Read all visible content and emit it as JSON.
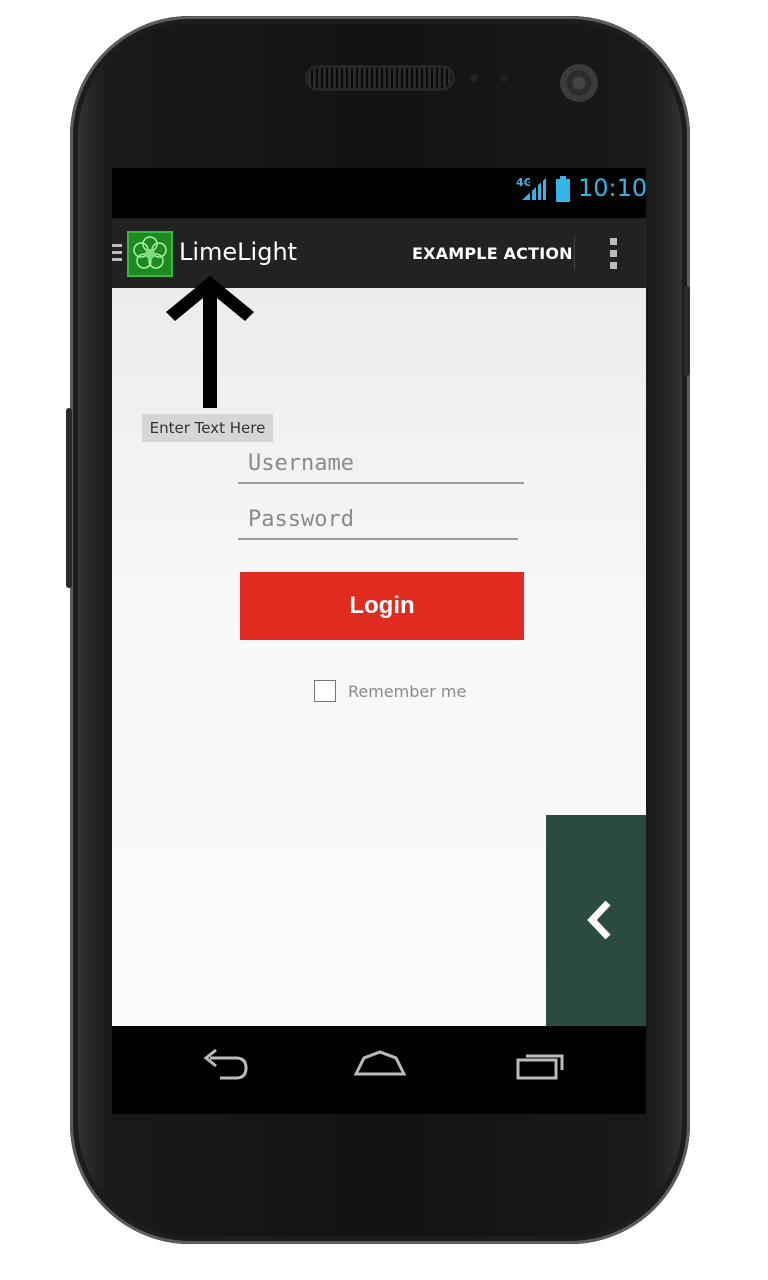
{
  "status_bar": {
    "network": "4G",
    "time": "10:10"
  },
  "action_bar": {
    "title": "LimeLight",
    "action_label": "EXAMPLE ACTION"
  },
  "tooltip": "Enter Text Here",
  "login_form": {
    "username_placeholder": "Username",
    "password_placeholder": "Password",
    "login_label": "Login",
    "remember_label": "Remember me"
  },
  "icons": {
    "logo": "clover-flower-icon",
    "drawer": "drawer-menu-icon",
    "overflow": "more-vertical-icon",
    "arrow": "arrow-up-icon",
    "panel": "chevron-left-icon",
    "nav": [
      "back-icon",
      "home-icon",
      "recent-apps-icon"
    ]
  },
  "colors": {
    "accent_blue": "#33b5e5",
    "login_red": "#e02b20",
    "action_bar": "#222222",
    "logo_green": "#1e8a1e",
    "panel_green": "#2a4a42"
  }
}
